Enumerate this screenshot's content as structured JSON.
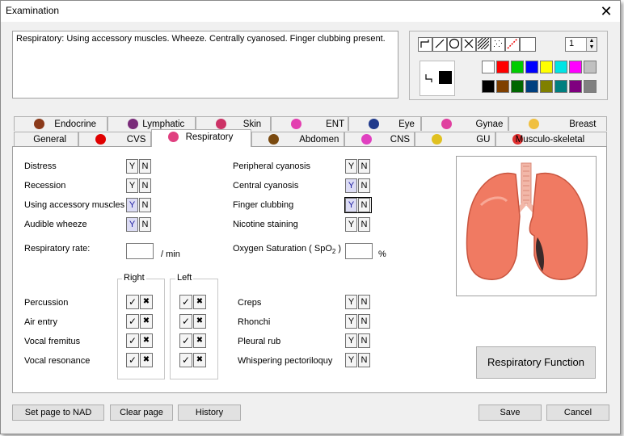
{
  "window": {
    "title": "Examination",
    "close_glyph": "✕"
  },
  "notes_text": "Respiratory: Using accessory muscles.  Wheeze.  Centrally cyanosed.  Finger clubbing present.",
  "drawing_tools": {
    "tools": [
      "freehand-line-tool",
      "straight-line-tool",
      "circle-tool",
      "cross-tool",
      "hatch-tool",
      "dots-tool",
      "dashed-line-tool",
      "blank-tool"
    ],
    "line_width": "1",
    "colors_row1": [
      "#ffffff",
      "#ff0000",
      "#00cc00",
      "#0000ff",
      "#ffff00",
      "#00e5e5",
      "#ff00ff",
      "#c0c0c0"
    ],
    "colors_row2": [
      "#000000",
      "#7f3f00",
      "#006600",
      "#003f7f",
      "#808000",
      "#007f7f",
      "#7f007f",
      "#808080"
    ]
  },
  "tabs_row1": [
    "Endocrine",
    "Lymphatic",
    "Skin",
    "ENT",
    "Eye",
    "Gynae",
    "Breast"
  ],
  "tabs_row2": [
    "General",
    "CVS",
    "Respiratory",
    "Abdomen",
    "CNS",
    "GU",
    "Musculo-skeletal"
  ],
  "active_tab": "Respiratory",
  "left_findings": [
    {
      "label": "Distress",
      "y": "Y",
      "n": "N",
      "selected": ""
    },
    {
      "label": "Recession",
      "y": "Y",
      "n": "N",
      "selected": ""
    },
    {
      "label": "Using accessory muscles",
      "y": "Y",
      "n": "N",
      "selected": "Y"
    },
    {
      "label": "Audible wheeze",
      "y": "Y",
      "n": "N",
      "selected": "Y"
    }
  ],
  "right_findings": [
    {
      "label": "Peripheral cyanosis",
      "y": "Y",
      "n": "N",
      "selected": ""
    },
    {
      "label": "Central cyanosis",
      "y": "Y",
      "n": "N",
      "selected": "Y"
    },
    {
      "label": "Finger clubbing",
      "y": "Y",
      "n": "N",
      "selected": "Y"
    },
    {
      "label": "Nicotine staining",
      "y": "Y",
      "n": "N",
      "selected": ""
    }
  ],
  "resp_rate": {
    "label": "Respiratory rate:",
    "unit": "/ min",
    "value": ""
  },
  "oxygen_sat": {
    "label": "Oxygen Saturation ( SpO",
    "sub": "2",
    "close": " )",
    "unit": "%",
    "value": ""
  },
  "side_headers": {
    "right": "Right",
    "left": "Left"
  },
  "check_marks": {
    "tick": "✓",
    "cross": "✖"
  },
  "exam_rows": [
    "Percussion",
    "Air entry",
    "Vocal fremitus",
    "Vocal resonance"
  ],
  "sound_findings": [
    {
      "label": "Creps",
      "y": "Y",
      "n": "N"
    },
    {
      "label": "Rhonchi",
      "y": "Y",
      "n": "N"
    },
    {
      "label": "Pleural rub",
      "y": "Y",
      "n": "N"
    },
    {
      "label": "Whispering pectoriloquy",
      "y": "Y",
      "n": "N"
    }
  ],
  "buttons": {
    "respiratory_function": "Respiratory Function",
    "set_page_nad": "Set page to NAD",
    "clear_page": "Clear page",
    "history": "History",
    "save": "Save",
    "cancel": "Cancel"
  }
}
